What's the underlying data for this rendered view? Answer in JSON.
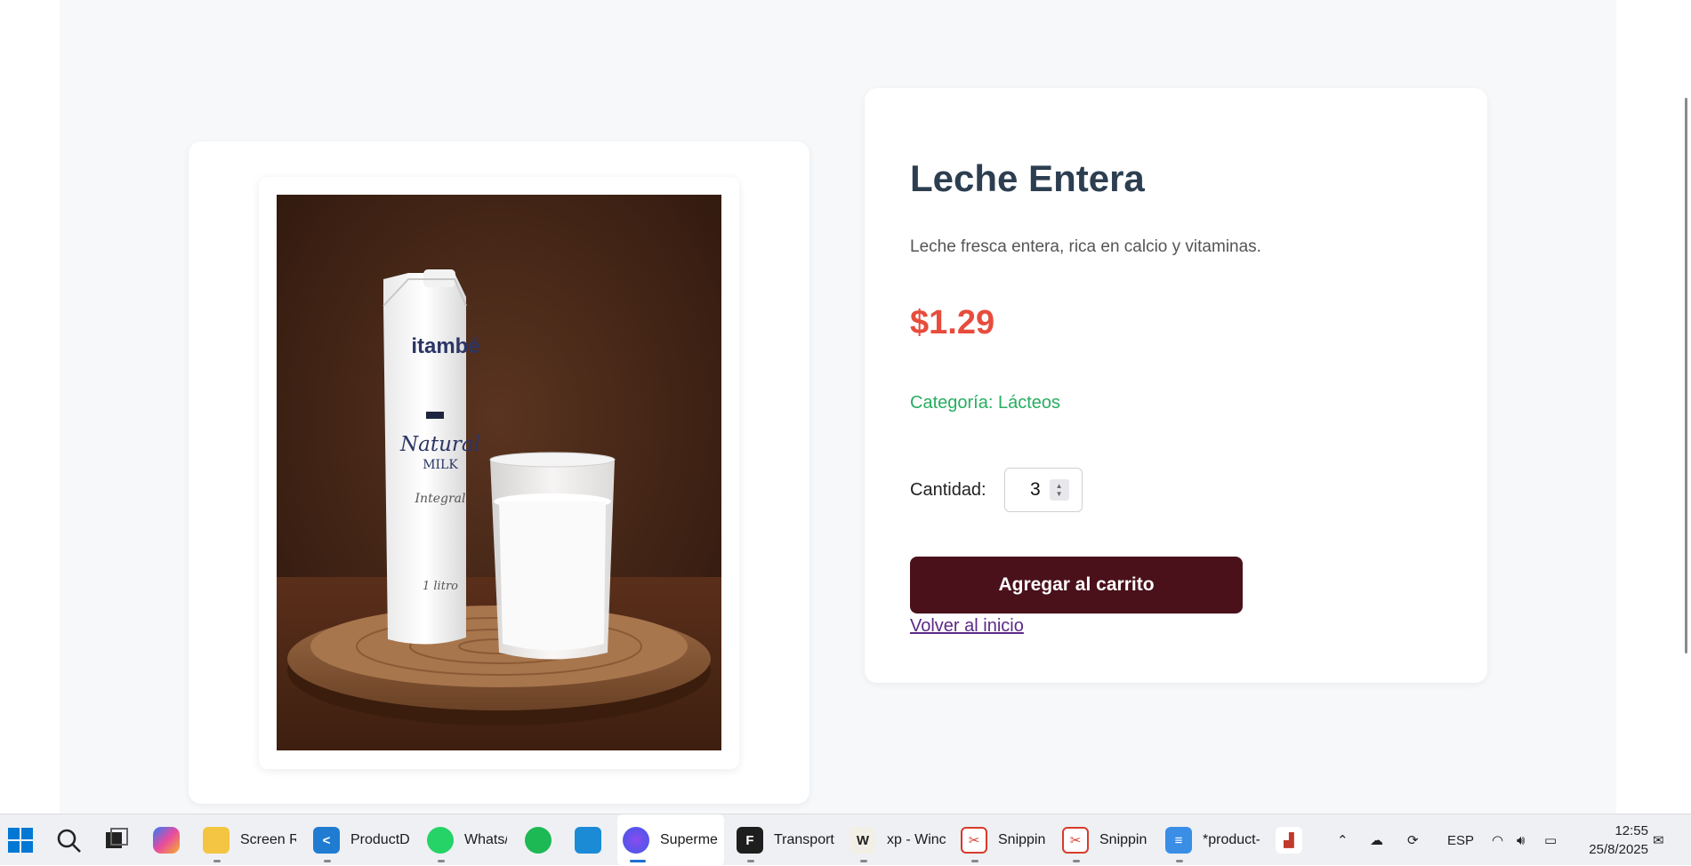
{
  "product": {
    "title": "Leche Entera",
    "description": "Leche fresca entera, rica en calcio y vitaminas.",
    "price": "$1.29",
    "category": "Categoría: Lácteos",
    "quantity_label": "Cantidad:",
    "quantity_value": "3",
    "add_button_label": "Agregar al carrito",
    "back_link_label": "Volver al inicio",
    "image": {
      "brand_text": "itambé",
      "product_text": "Natural",
      "milk_text": "MILK",
      "variety_text": "Integral",
      "volume_text": "1 litro"
    }
  },
  "colors": {
    "title": "#2c3e50",
    "price": "#e74c3c",
    "category": "#27ae60",
    "button": "#4a111b",
    "link": "#5b2a86"
  },
  "taskbar": {
    "items": [
      {
        "icon": "folder-icon",
        "label": "Screen Re"
      },
      {
        "icon": "vscode-icon",
        "label": "ProductD"
      },
      {
        "icon": "whatsapp-icon",
        "label": "Whats/"
      },
      {
        "icon": "spotify-icon",
        "label": ""
      },
      {
        "icon": "vmware-icon",
        "label": ""
      },
      {
        "icon": "firefox-icon",
        "label": "Superme"
      },
      {
        "icon": "figma-icon",
        "label": "Transport"
      },
      {
        "icon": "wincmd-icon",
        "label": "xp - Winc"
      },
      {
        "icon": "snipping-icon",
        "label": "Snippin"
      },
      {
        "icon": "snipping-icon",
        "label": "Snippin"
      },
      {
        "icon": "notepad-icon",
        "label": "*product-"
      }
    ],
    "language": "ESP",
    "time": "12:55",
    "date": "25/8/2025"
  }
}
